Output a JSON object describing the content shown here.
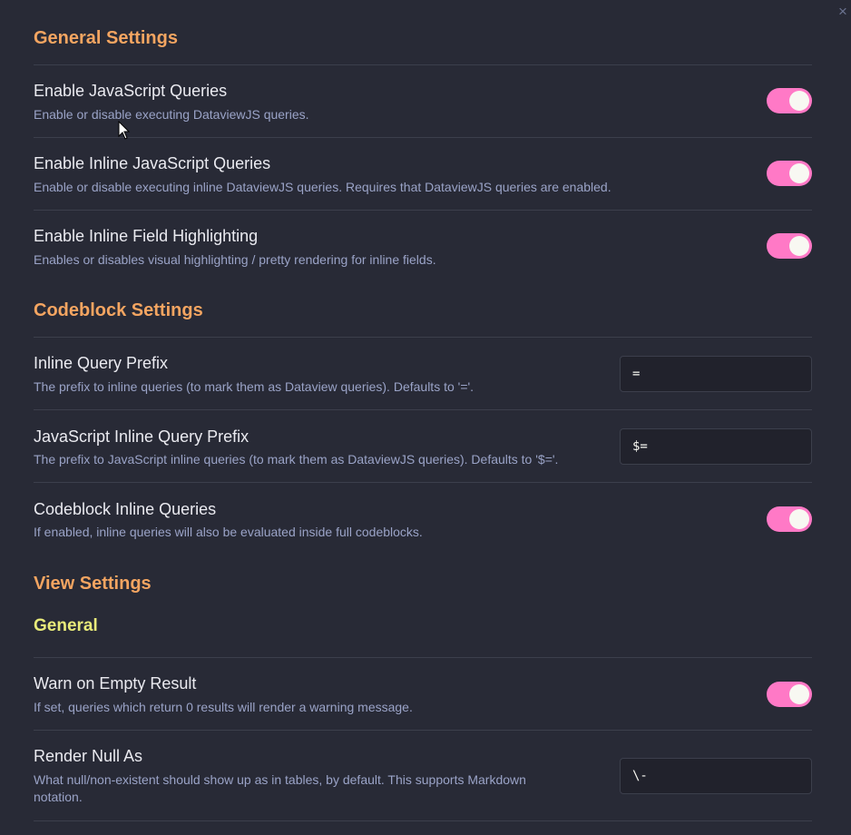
{
  "close_label": "×",
  "sections": {
    "general": {
      "title": "General Settings",
      "items": [
        {
          "name": "Enable JavaScript Queries",
          "desc": "Enable or disable executing DataviewJS queries.",
          "enabled": true
        },
        {
          "name": "Enable Inline JavaScript Queries",
          "desc": "Enable or disable executing inline DataviewJS queries. Requires that DataviewJS queries are enabled.",
          "enabled": true
        },
        {
          "name": "Enable Inline Field Highlighting",
          "desc": "Enables or disables visual highlighting / pretty rendering for inline fields.",
          "enabled": true
        }
      ]
    },
    "codeblock": {
      "title": "Codeblock Settings",
      "items": [
        {
          "name": "Inline Query Prefix",
          "desc": "The prefix to inline queries (to mark them as Dataview queries). Defaults to '='.",
          "value": "="
        },
        {
          "name": "JavaScript Inline Query Prefix",
          "desc": "The prefix to JavaScript inline queries (to mark them as DataviewJS queries). Defaults to '$='.",
          "value": "$="
        },
        {
          "name": "Codeblock Inline Queries",
          "desc": "If enabled, inline queries will also be evaluated inside full codeblocks.",
          "enabled": true
        }
      ]
    },
    "view": {
      "title": "View Settings",
      "subtitle": "General",
      "items": [
        {
          "name": "Warn on Empty Result",
          "desc": "If set, queries which return 0 results will render a warning message.",
          "enabled": true
        },
        {
          "name": "Render Null As",
          "desc": "What null/non-existent should show up as in tables, by default. This supports Markdown notation.",
          "value": "\\-"
        }
      ]
    }
  },
  "colors": {
    "background": "#282a36",
    "section_heading": "#f4a561",
    "sub_heading": "#e8ea7a",
    "toggle_on": "#ff79c6",
    "description": "#9aa3c7"
  }
}
